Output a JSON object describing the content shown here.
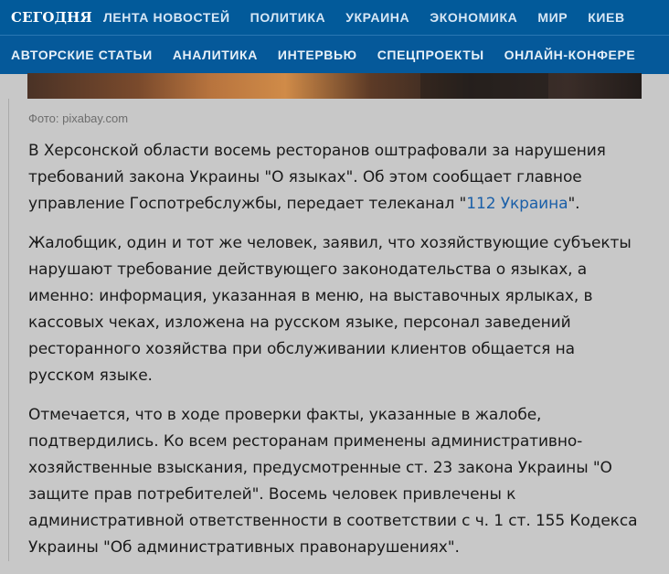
{
  "header": {
    "logo": "СЕГОДНЯ",
    "primary_nav": [
      "ЛЕНТА НОВОСТЕЙ",
      "ПОЛИТИКА",
      "УКРАИНА",
      "ЭКОНОМИКА",
      "МИР",
      "КИЕВ"
    ],
    "secondary_nav": [
      "АВТОРСКИЕ СТАТЬИ",
      "АНАЛИТИКА",
      "ИНТЕРВЬЮ",
      "СПЕЦПРОЕКТЫ",
      "ОНЛАЙН-КОНФЕРЕ"
    ]
  },
  "article": {
    "photo_caption": "Фото: pixabay.com",
    "p1": {
      "line1": "В Херсонской области восемь ресторанов оштрафовали за нарушения",
      "line2": "требований закона Украины \"О языках\". Об этом сообщает главное",
      "line3_prefix": "управление Госпотребслужбы, передает телеканал \"",
      "line3_link": "112 Украина",
      "line3_suffix": "\"."
    },
    "p2": [
      "Жалобщик, один и тот же человек, заявил, что хозяйствующие субъекты",
      "нарушают требование действующего законодательства о языках, а",
      "именно: информация, указанная в меню, на выставочных ярлыках, в",
      "кассовых чеках, изложена на русском языке, персонал заведений",
      "ресторанного хозяйства при обслуживании клиентов общается на",
      "русском языке."
    ],
    "p3": [
      "Отмечается, что в ходе проверки факты, указанные в жалобе,",
      "подтвердились. Ко всем ресторанам применены административно-",
      "хозяйственные взыскания, предусмотренные ст. 23 закона Украины \"О",
      "защите прав потребителей\". Восемь человек привлечены к",
      "административной ответственности в соответствии с ч. 1 ст. 155 Кодекса",
      "Украины \"Об административных правонарушениях\"."
    ]
  }
}
